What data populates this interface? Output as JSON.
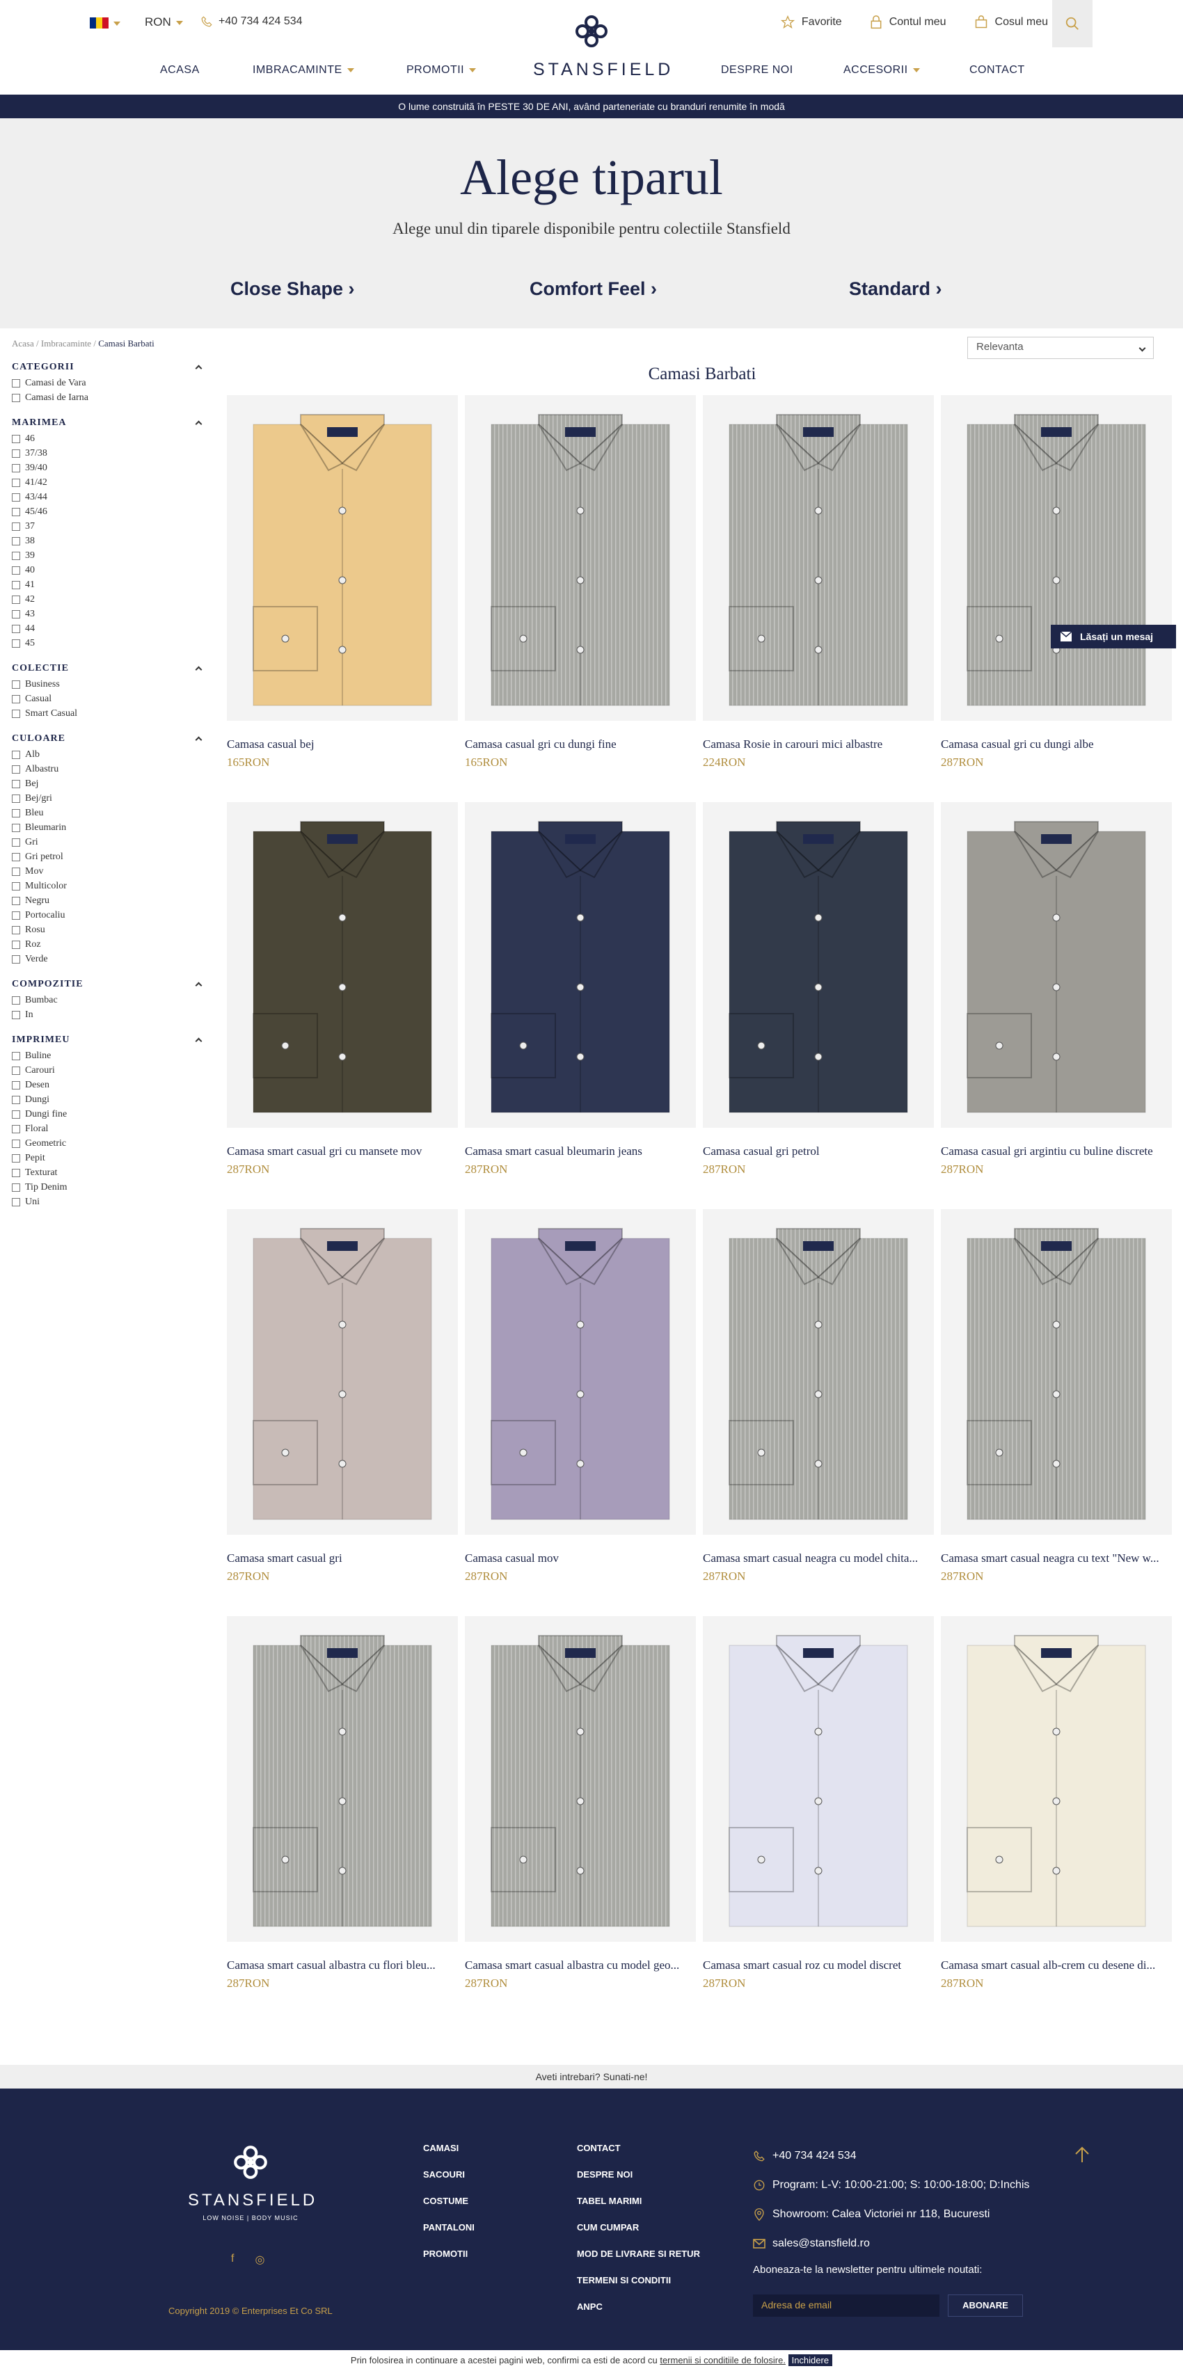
{
  "header": {
    "currency": "RON",
    "phone": "+40 734 424 534",
    "logo": "STANSFIELD",
    "links": {
      "favorites": "Favorite",
      "account": "Contul meu",
      "cart": "Cosul meu"
    },
    "nav": [
      "ACASA",
      "IMBRACAMINTE",
      "PROMOTII",
      "DESPRE NOI",
      "ACCESORII",
      "CONTACT"
    ],
    "flag_colors": [
      "#002b7f",
      "#fcd116",
      "#ce1126"
    ]
  },
  "banner": "O lume construită în PESTE 30 DE ANI, având parteneriate cu branduri renumite în modă",
  "hero": {
    "title": "Alege tiparul",
    "subtitle": "Alege unul din tiparele disponibile pentru colectiile Stansfield",
    "fits": [
      "Close Shape ›",
      "Comfort Feel ›",
      "Standard ›"
    ]
  },
  "breadcrumb": {
    "home": "Acasa",
    "sep": "/",
    "section": "Imbracaminte",
    "current": "Camasi Barbati"
  },
  "sort": {
    "selected": "Relevanta"
  },
  "listing_title": "Camasi Barbati",
  "filters": [
    {
      "title": "CATEGORII",
      "options": [
        "Camasi de Vara",
        "Camasi de Iarna"
      ]
    },
    {
      "title": "MARIMEA",
      "options": [
        "46",
        "37/38",
        "39/40",
        "41/42",
        "43/44",
        "45/46",
        "37",
        "38",
        "39",
        "40",
        "41",
        "42",
        "43",
        "44",
        "45"
      ]
    },
    {
      "title": "COLECTIE",
      "options": [
        "Business",
        "Casual",
        "Smart Casual"
      ]
    },
    {
      "title": "CULOARE",
      "options": [
        "Alb",
        "Albastru",
        "Bej",
        "Bej/gri",
        "Bleu",
        "Bleumarin",
        "Gri",
        "Gri petrol",
        "Mov",
        "Multicolor",
        "Negru",
        "Portocaliu",
        "Rosu",
        "Roz",
        "Verde"
      ]
    },
    {
      "title": "COMPOZITIE",
      "options": [
        "Bumbac",
        "In"
      ]
    },
    {
      "title": "IMPRIMEU",
      "options": [
        "Buline",
        "Carouri",
        "Desen",
        "Dungi",
        "Dungi fine",
        "Floral",
        "Geometric",
        "Pepit",
        "Texturat",
        "Tip Denim",
        "Uni"
      ]
    }
  ],
  "products": [
    {
      "name": "Camasa casual bej",
      "price": "165RON",
      "color": "#ecc98c",
      "pattern": "plain"
    },
    {
      "name": "Camasa casual gri cu dungi fine",
      "price": "165RON",
      "color": "#a7a8a3",
      "pattern": "stripes"
    },
    {
      "name": "Camasa Rosie in carouri mici albastre",
      "price": "224RON",
      "color": "#a8335d",
      "pattern": "check"
    },
    {
      "name": "Camasa casual gri cu dungi albe",
      "price": "287RON",
      "color": "#c9c4cb",
      "pattern": "stripes"
    },
    {
      "name": "Camasa smart casual gri cu mansete mov",
      "price": "287RON",
      "color": "#4a4637",
      "pattern": "plain"
    },
    {
      "name": "Camasa smart casual bleumarin jeans",
      "price": "287RON",
      "color": "#2e3652",
      "pattern": "plain"
    },
    {
      "name": "Camasa casual gri petrol",
      "price": "287RON",
      "color": "#323a4a",
      "pattern": "plain"
    },
    {
      "name": "Camasa casual gri argintiu cu buline discrete",
      "price": "287RON",
      "color": "#9d9b95",
      "pattern": "plain"
    },
    {
      "name": "Camasa smart casual gri",
      "price": "287RON",
      "color": "#c8bbb7",
      "pattern": "plain"
    },
    {
      "name": "Camasa casual mov",
      "price": "287RON",
      "color": "#a79cba",
      "pattern": "plain"
    },
    {
      "name": "Camasa smart casual neagra cu model chita...",
      "price": "287RON",
      "color": "#2a2422",
      "pattern": "print-red"
    },
    {
      "name": "Camasa smart casual neagra cu text \"New w...",
      "price": "287RON",
      "color": "#3a3835",
      "pattern": "dots"
    },
    {
      "name": "Camasa smart casual albastra cu flori bleu...",
      "price": "287RON",
      "color": "#34404e",
      "pattern": "dots-dark"
    },
    {
      "name": "Camasa smart casual albastra cu model geo...",
      "price": "287RON",
      "color": "#2d3140",
      "pattern": "geo"
    },
    {
      "name": "Camasa smart casual roz cu model discret",
      "price": "287RON",
      "color": "#e2e3f0",
      "pattern": "plain"
    },
    {
      "name": "Camasa smart casual alb-crem cu desene di...",
      "price": "287RON",
      "color": "#f1ecdc",
      "pattern": "plain"
    }
  ],
  "chat_button": "Lăsați un mesaj",
  "footer_question": "Aveti intrebari? Sunati-ne!",
  "footer": {
    "logo": "STANSFIELD",
    "tagline": "LOW NOISE | BODY MUSIC",
    "social": [
      "f",
      "◎"
    ],
    "copyright": "Copyright 2019 © Enterprises Et Co SRL",
    "col1": [
      "CAMASI",
      "SACOURI",
      "COSTUME",
      "PANTALONI",
      "PROMOTII"
    ],
    "col2": [
      "CONTACT",
      "DESPRE NOI",
      "TABEL MARIMI",
      "CUM CUMPAR",
      "MOD DE LIVRARE SI RETUR",
      "TERMENI SI CONDITII",
      "ANPC"
    ],
    "contact": {
      "phone": "+40 734 424 534",
      "hours": "Program: L-V: 10:00-21:00; S: 10:00-18:00; D:Inchis",
      "showroom": "Showroom: Calea Victoriei nr 118, Bucuresti",
      "email": "sales@stansfield.ro"
    },
    "newsletter_label": "Aboneaza-te la newsletter pentru ultimele noutati:",
    "newsletter_placeholder": "Adresa de email",
    "newsletter_button": "ABONARE"
  },
  "cookie": {
    "text": "Prin folosirea in continuare a acestei pagini web, confirmi ca esti de acord cu",
    "link": "termenii si conditiile de folosire.",
    "close": "Inchidere"
  },
  "colors": {
    "navy": "#1d2548",
    "gold": "#c8a04a",
    "price": "#b08d3c"
  }
}
